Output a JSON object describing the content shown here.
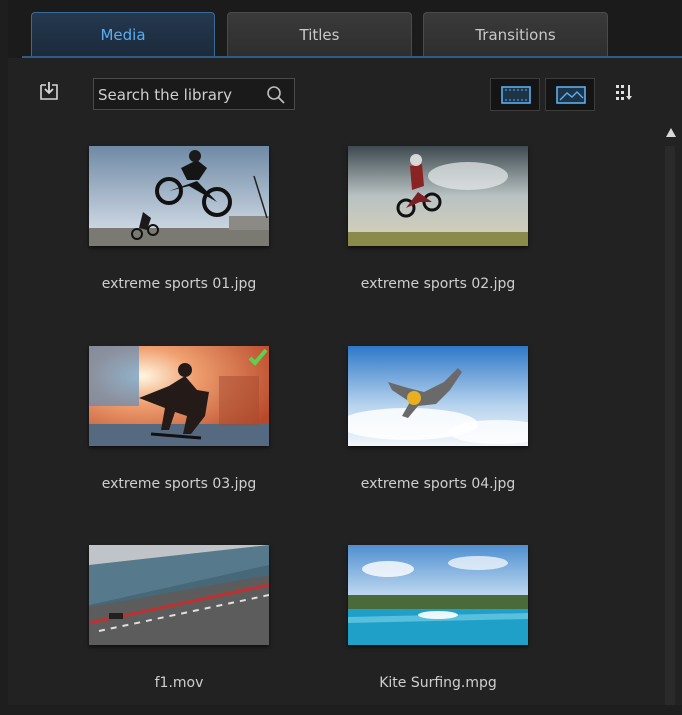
{
  "tabs": [
    {
      "label": "Media",
      "active": true
    },
    {
      "label": "Titles",
      "active": false
    },
    {
      "label": "Transitions",
      "active": false
    }
  ],
  "toolbar": {
    "search_text": "Search the library",
    "icons": [
      "import-media-icon",
      "search-icon",
      "storyboard-view-icon",
      "image-view-icon",
      "sort-grid-icon"
    ]
  },
  "media": [
    {
      "name": "extreme sports 01.jpg",
      "selected": false
    },
    {
      "name": "extreme sports 02.jpg",
      "selected": false
    },
    {
      "name": "extreme sports 03.jpg",
      "selected": true
    },
    {
      "name": "extreme sports 04.jpg",
      "selected": false
    },
    {
      "name": "f1.mov",
      "selected": false
    },
    {
      "name": "Kite Surfing.mpg",
      "selected": false
    }
  ],
  "colors": {
    "accent": "#5aaef0",
    "tab_active_border": "#3a6a98",
    "check": "#5fcf4f"
  }
}
